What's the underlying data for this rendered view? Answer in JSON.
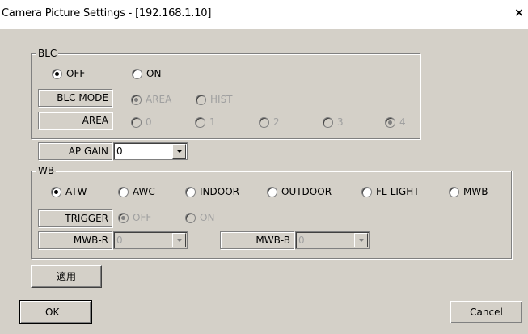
{
  "window": {
    "title": "Camera Picture Settings - [192.168.1.10]",
    "close_glyph": "×"
  },
  "blc": {
    "legend": "BLC",
    "off_label": "OFF",
    "on_label": "ON",
    "mode_label": "BLC MODE",
    "mode_area": "AREA",
    "mode_hist": "HIST",
    "area_label": "AREA",
    "area_options": [
      "0",
      "1",
      "2",
      "3",
      "4"
    ],
    "selected_area": "4"
  },
  "ap_gain": {
    "label": "AP GAIN",
    "value": "0"
  },
  "wb": {
    "legend": "WB",
    "modes": [
      "ATW",
      "AWC",
      "INDOOR",
      "OUTDOOR",
      "FL-LIGHT",
      "MWB"
    ],
    "selected": "ATW",
    "trigger_label": "TRIGGER",
    "trigger_off": "OFF",
    "trigger_on": "ON",
    "mwb_r_label": "MWB-R",
    "mwb_r_value": "0",
    "mwb_b_label": "MWB-B",
    "mwb_b_value": "0"
  },
  "buttons": {
    "apply": "適用",
    "ok": "OK",
    "cancel": "Cancel"
  }
}
